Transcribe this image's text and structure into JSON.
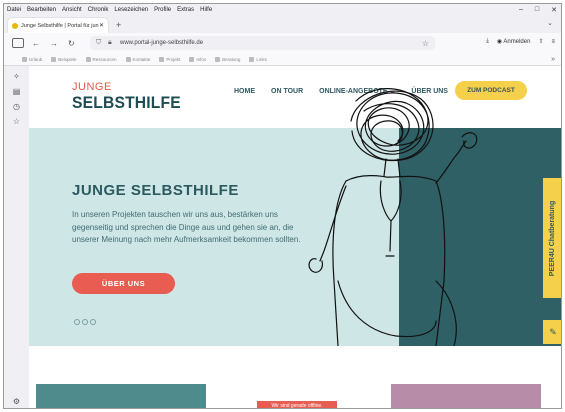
{
  "menubar": {
    "items": [
      "Datei",
      "Bearbeiten",
      "Ansicht",
      "Chronik",
      "Lesezeichen",
      "Profile",
      "Extras",
      "Hilfe"
    ],
    "min": "–",
    "max": "□",
    "close": "✕"
  },
  "tabs": [
    {
      "label": "Junge Selbsthilfe | Portal für jun",
      "close": "✕"
    }
  ],
  "newtab": "+",
  "tabchevron": "⌄",
  "nav": {
    "back": "←",
    "forward": "→",
    "reload": "↻",
    "url": "www.portal-junge-selbsthilfe.de",
    "star": "☆",
    "download": "⤓",
    "account": "Anmelden",
    "extensions": "⇧",
    "menu": "≡"
  },
  "bookmarks": [
    "Urlaub",
    "Beispiele",
    "Ressourcen",
    "Kontakte",
    "Projekt",
    "Infos",
    "Beratung",
    "Links"
  ],
  "bookmarks_more": "»",
  "sidebar": {
    "icons": [
      "✧",
      "▤",
      "◷",
      "☆"
    ],
    "settings": "⚙"
  },
  "site": {
    "logo_top": "JUNGE",
    "logo_bottom": "SELBSTHILFE",
    "nav": [
      "HOME",
      "ON TOUR",
      "ONLINE-ANGEBOTE ⌄",
      "ÜBER UNS"
    ],
    "podcast": "ZUM PODCAST",
    "hero_title": "JUNGE SELBSTHILFE",
    "hero_text": "In unseren Projekten tauschen wir uns aus, bestärken uns gegenseitig und sprechen die Dinge aus und gehen sie an, die unserer Meinung nach mehr Aufmerksamkeit bekommen sollten.",
    "hero_button": "ÜBER UNS",
    "chat_tab": "PEER4U Chatberatung",
    "chat_icon": "✎",
    "offline": "Wir sind gerade offline."
  },
  "colors": {
    "teal": "#2f6066",
    "mint": "#cfe6e6",
    "coral": "#e85c52",
    "yellow": "#f5d04a"
  }
}
